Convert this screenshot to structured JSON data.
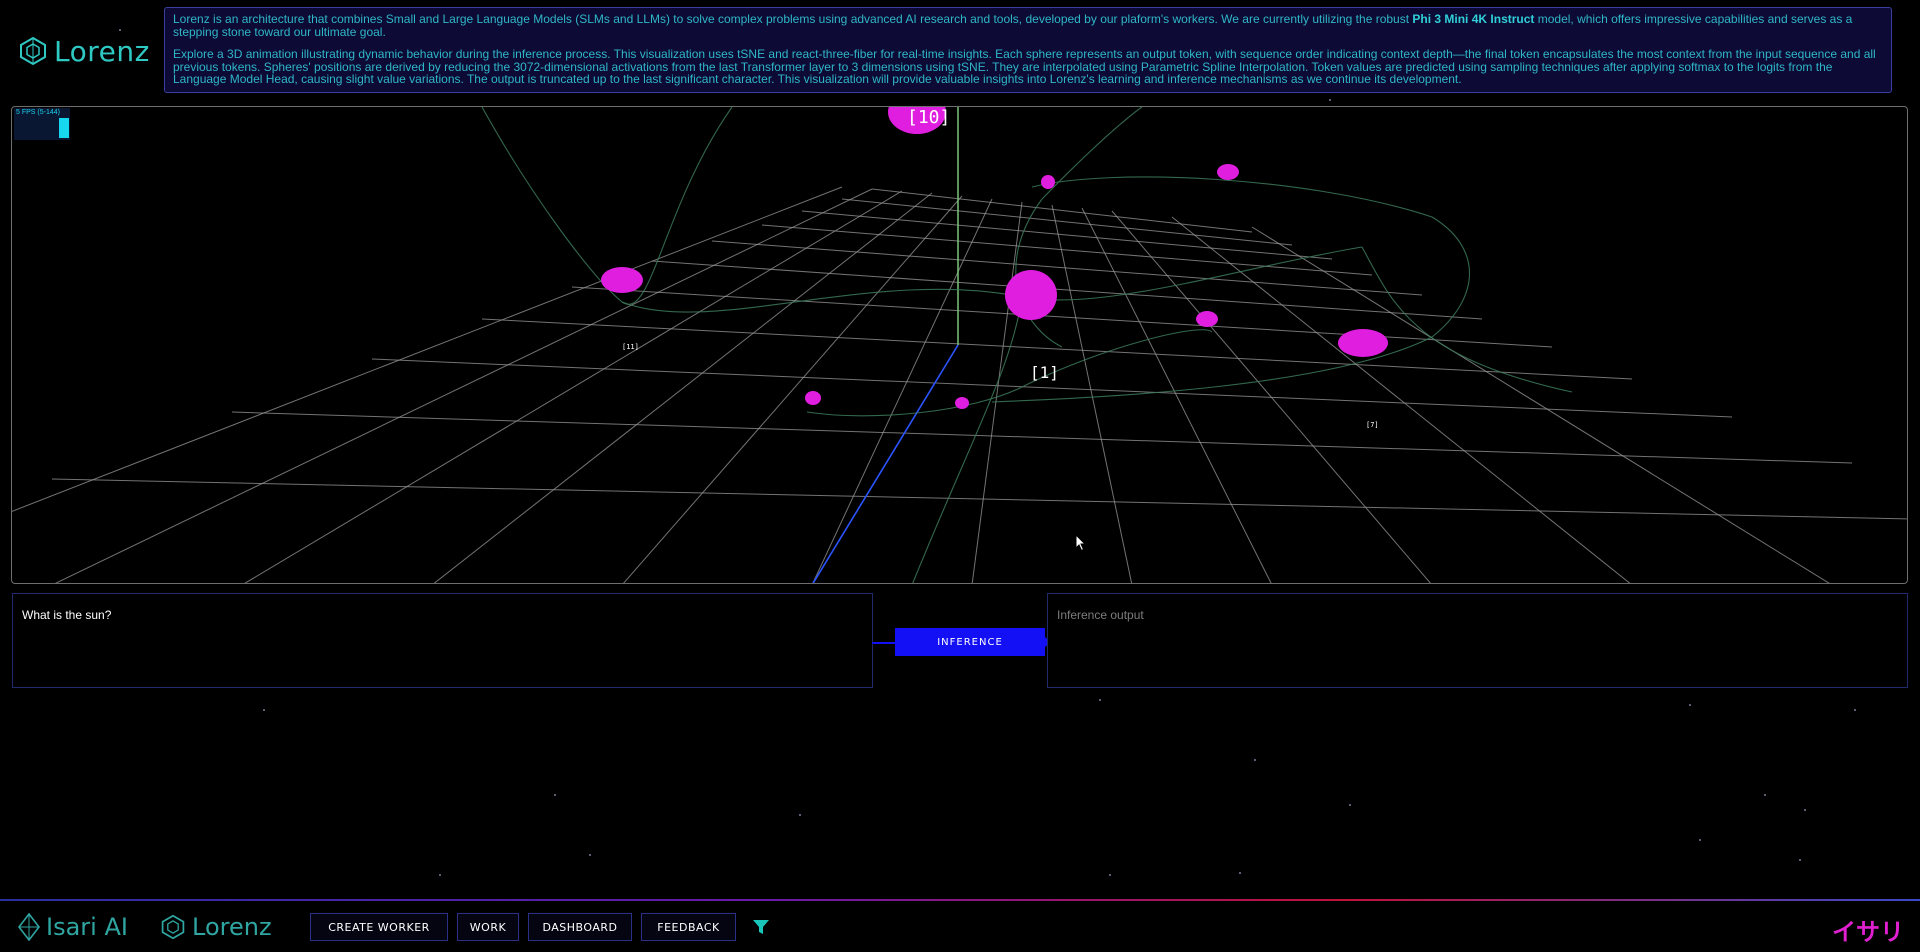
{
  "header": {
    "logo_text": "Lorenz",
    "intro_p1_before": "Lorenz is an architecture that combines Small and Large Language Models (SLMs and LLMs) to solve complex problems using advanced AI research and tools, developed by our plaform's workers. We are currently utilizing the robust ",
    "intro_p1_bold": "Phi 3 Mini 4K Instruct",
    "intro_p1_after": " model, which offers impressive capabilities and serves as a stepping stone toward our ultimate goal.",
    "intro_p2": "Explore a 3D animation illustrating dynamic behavior during the inference process. This visualization uses tSNE and react-three-fiber for real-time insights. Each sphere represents an output token, with sequence order indicating context depth—the final token encapsulates the most context from the input sequence and all previous tokens. Spheres' positions are derived by reducing the 3072-dimensional activations from the last Transformer layer to 3 dimensions using tSNE. They are interpolated using Parametric Spline Interpolation. Token values are predicted using sampling techniques after applying softmax to the logits from the Language Model Head, causing slight value variations. The output is truncated up to the last significant character. This visualization will provide valuable insights into Lorenz's learning and inference mechanisms as we continue its development."
  },
  "viewport": {
    "fps_label": "5 FPS (5-144)",
    "tokens": [
      {
        "label": "[10]"
      },
      {
        "label": "[1]"
      },
      {
        "label": "[11]"
      },
      {
        "label": "[7]"
      }
    ]
  },
  "prompt": {
    "value": "What is the sun?"
  },
  "infer_button": {
    "label": "INFERENCE"
  },
  "output": {
    "placeholder": "Inference output"
  },
  "footer": {
    "brand_isari": "Isari AI",
    "brand_lorenz": "Lorenz",
    "nav": [
      {
        "label": "CREATE WORKER"
      },
      {
        "label": "WORK"
      },
      {
        "label": "DASHBOARD"
      },
      {
        "label": "FEEDBACK"
      }
    ],
    "jp_logo": "イサリ"
  },
  "colors": {
    "accent_teal": "#2fc9c4",
    "sphere_magenta": "#e01ee0",
    "button_blue": "#1410f5"
  }
}
